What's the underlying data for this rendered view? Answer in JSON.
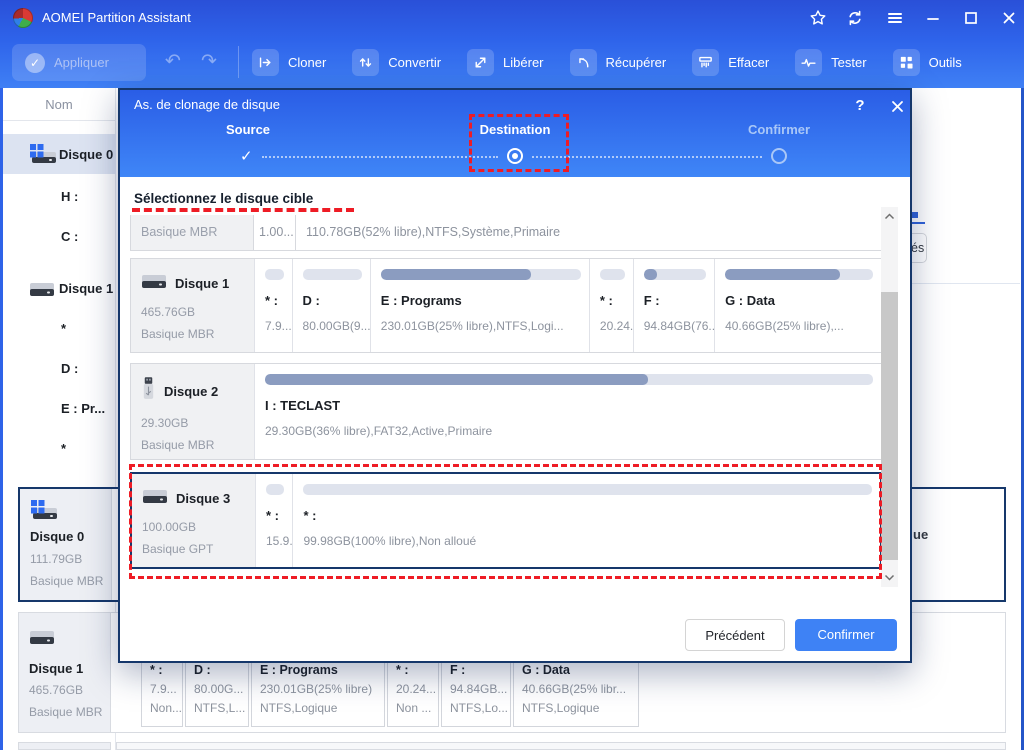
{
  "window": {
    "title": "AOMEI Partition Assistant"
  },
  "toolbar": {
    "apply_label": "Appliquer",
    "items": [
      {
        "label": "Cloner",
        "icon": "clone-arrow-icon"
      },
      {
        "label": "Convertir",
        "icon": "convert-arrows-icon"
      },
      {
        "label": "Libérer",
        "icon": "free-space-icon"
      },
      {
        "label": "Récupérer",
        "icon": "recover-arrow-icon"
      },
      {
        "label": "Effacer",
        "icon": "wipe-shredder-icon"
      },
      {
        "label": "Tester",
        "icon": "test-pulse-icon"
      },
      {
        "label": "Outils",
        "icon": "tools-grid-icon"
      }
    ]
  },
  "sidebar": {
    "header": "Nom",
    "items": [
      {
        "label": "Disque 0",
        "icon": "disk-windows",
        "selected": true
      },
      {
        "label": "H :"
      },
      {
        "label": "C :"
      },
      {
        "label": "Disque 1",
        "icon": "disk"
      },
      {
        "label": "*"
      },
      {
        "label": "D :"
      },
      {
        "label": "E : Pr..."
      },
      {
        "label": "*"
      }
    ]
  },
  "background": {
    "disk_panels": [
      {
        "name": "Disque 0",
        "size": "111.79GB",
        "type": "Basique MBR",
        "icon": "disk-windows",
        "selected": true
      },
      {
        "name": "Disque 1",
        "size": "465.76GB",
        "type": "Basique MBR",
        "icon": "disk",
        "selected": false
      }
    ],
    "disk1_partitions": [
      {
        "label": "* :",
        "size": "7.9...",
        "fs": "Non..."
      },
      {
        "label": "D :",
        "size": "80.00G...",
        "fs": "NTFS,L..."
      },
      {
        "label": "E : Programs",
        "size": "230.01GB(25% libre)",
        "fs": "NTFS,Logique"
      },
      {
        "label": "* :",
        "size": "20.24...",
        "fs": "Non ..."
      },
      {
        "label": "F :",
        "size": "94.84GB...",
        "fs": "NTFS,Lo..."
      },
      {
        "label": "G : Data",
        "size": "40.66GB(25% libr...",
        "fs": "NTFS,Logique"
      }
    ],
    "right_edge": {
      "button_fragment": "és",
      "text_fragment": "ue"
    }
  },
  "dialog": {
    "title": "As. de clonage de disque",
    "help_label": "?",
    "steps": [
      {
        "label": "Source",
        "state": "done"
      },
      {
        "label": "Destination",
        "state": "current"
      },
      {
        "label": "Confirmer",
        "state": "upcoming"
      }
    ],
    "select_label": "Sélectionnez le disque cible",
    "partial_row": {
      "col1": "Basique MBR",
      "col2": "1.00...",
      "col3": "110.78GB(52% libre),NTFS,Système,Primaire"
    },
    "disks": [
      {
        "name": "Disque 1",
        "size": "465.76GB",
        "type": "Basique MBR",
        "icon": "disk",
        "selected": false,
        "partitions": [
          {
            "label": "* :",
            "info": "7.9...",
            "fill": 0,
            "w": 6
          },
          {
            "label": "D :",
            "info": "80.00GB(9...",
            "fill": 0,
            "w": 12.5
          },
          {
            "label": "E : Programs",
            "info": "230.01GB(25% libre),NTFS,Logi...",
            "fill": 75,
            "w": 35
          },
          {
            "label": "* :",
            "info": "20.24...",
            "fill": 0,
            "w": 7
          },
          {
            "label": "F :",
            "info": "94.84GB(76...",
            "fill": 22,
            "w": 13
          },
          {
            "label": "G : Data",
            "info": "40.66GB(25% libre),...",
            "fill": 78,
            "w": 26.5
          }
        ]
      },
      {
        "name": "Disque 2",
        "size": "29.30GB",
        "type": "Basique MBR",
        "icon": "usb",
        "selected": false,
        "partitions": [
          {
            "label": "I : TECLAST",
            "info": "29.30GB(36% libre),FAT32,Active,Primaire",
            "fill": 63,
            "w": 100
          }
        ]
      },
      {
        "name": "Disque 3",
        "size": "100.00GB",
        "type": "Basique GPT",
        "icon": "disk",
        "selected": true,
        "partitions": [
          {
            "label": "* :",
            "info": "15.9...",
            "fill": 0,
            "w": 6
          },
          {
            "label": "* :",
            "info": "99.98GB(100% libre),Non alloué",
            "fill": 0,
            "w": 94
          }
        ]
      }
    ],
    "buttons": {
      "previous": "Précédent",
      "confirm": "Confirmer"
    }
  },
  "colors": {
    "accent": "#3e82f5",
    "danger_dashed": "#ee1c25",
    "selection_border": "#15376b",
    "bar_fill": "#8b9cc0",
    "bar_track": "#dfe3ed"
  }
}
